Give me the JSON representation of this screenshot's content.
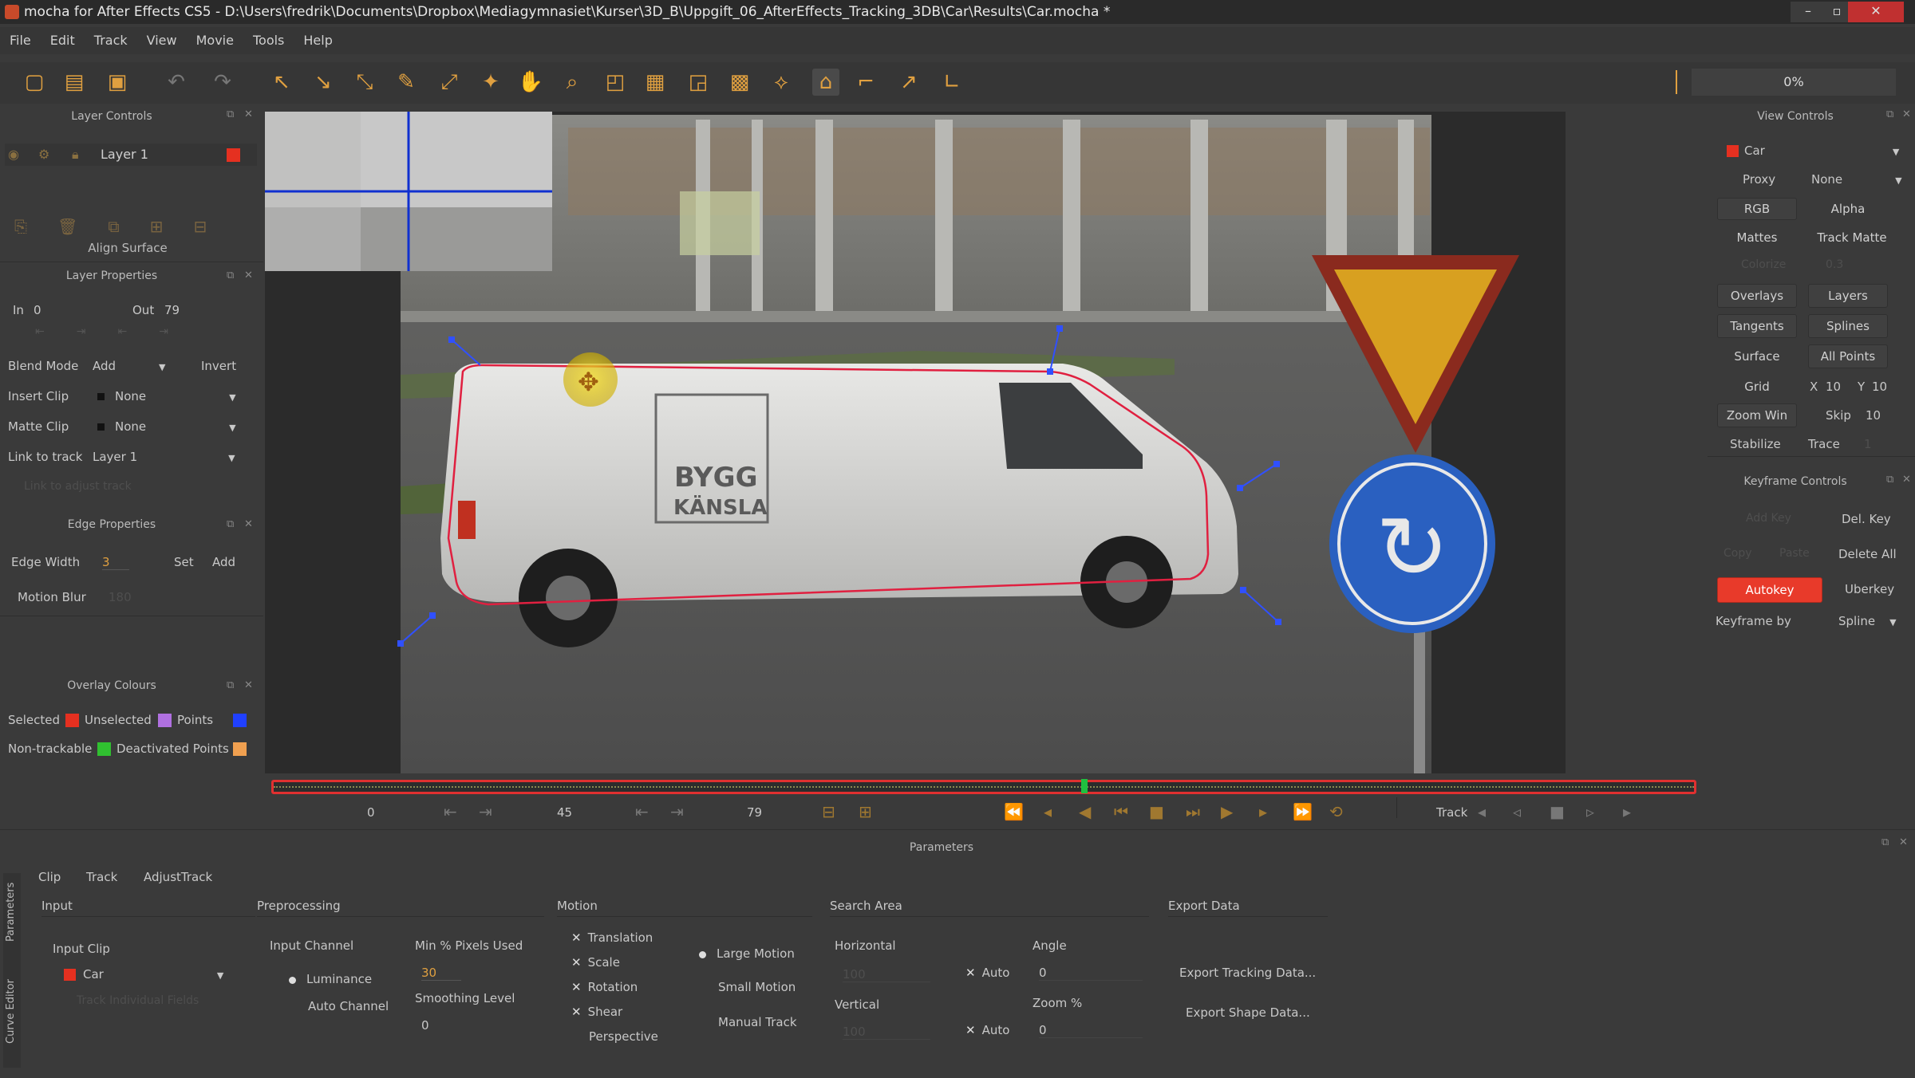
{
  "title": "mocha for After Effects CS5 - D:\\Users\\fredrik\\Documents\\Dropbox\\Mediagymnasiet\\Kurser\\3D_B\\Uppgift_06_AfterEffects_Tracking_3DB\\Car\\Results\\Car.mocha *",
  "menu": [
    "File",
    "Edit",
    "Track",
    "View",
    "Movie",
    "Tools",
    "Help"
  ],
  "progress": "0%",
  "layer_controls": {
    "header": "Layer Controls",
    "layer_name": "Layer 1",
    "align_surface": "Align Surface"
  },
  "layer_properties": {
    "header": "Layer Properties",
    "in_label": "In",
    "in_value": "0",
    "out_label": "Out",
    "out_value": "79",
    "blend_mode_label": "Blend Mode",
    "blend_mode_value": "Add",
    "invert": "Invert",
    "insert_clip_label": "Insert Clip",
    "insert_clip_value": "None",
    "matte_clip_label": "Matte Clip",
    "matte_clip_value": "None",
    "link_to_track_label": "Link to track",
    "link_to_track_value": "Layer 1",
    "link_to_adjust": "Link to adjust track"
  },
  "edge_properties": {
    "header": "Edge Properties",
    "edge_width_label": "Edge Width",
    "edge_width_value": "3",
    "set": "Set",
    "add": "Add",
    "motion_blur_label": "Motion Blur",
    "motion_blur_value": "180"
  },
  "overlay_colours": {
    "header": "Overlay Colours",
    "selected": "Selected",
    "unselected": "Unselected",
    "points": "Points",
    "non_trackable": "Non-trackable",
    "deactivated_points": "Deactivated Points",
    "colors": {
      "selected": "#e53020",
      "unselected": "#b070e0",
      "points": "#2040ff",
      "non_trackable": "#30c030",
      "deactivated": "#f0a050"
    }
  },
  "view_controls": {
    "header": "View Controls",
    "clip": "Car",
    "proxy_label": "Proxy",
    "proxy_value": "None",
    "rgb": "RGB",
    "alpha": "Alpha",
    "mattes": "Mattes",
    "track_matte": "Track Matte",
    "colorize": "Colorize",
    "colorize_value": "0.3",
    "overlays": "Overlays",
    "layers": "Layers",
    "tangents": "Tangents",
    "splines": "Splines",
    "surface": "Surface",
    "all_points": "All Points",
    "grid": "Grid",
    "grid_x_label": "X",
    "grid_x": "10",
    "grid_y_label": "Y",
    "grid_y": "10",
    "zoom_win": "Zoom Win",
    "skip": "Skip",
    "skip_value": "10",
    "stabilize": "Stabilize",
    "trace": "Trace",
    "trace_value": "1"
  },
  "keyframe_controls": {
    "header": "Keyframe Controls",
    "add_key": "Add Key",
    "del_key": "Del. Key",
    "copy": "Copy",
    "paste": "Paste",
    "delete_all": "Delete All",
    "autokey": "Autokey",
    "uberkey": "Uberkey",
    "keyframe_by_label": "Keyframe by",
    "keyframe_by_value": "Spline"
  },
  "timeline": {
    "start": "0",
    "mid": "45",
    "end": "79",
    "track_label": "Track"
  },
  "parameters": {
    "header": "Parameters",
    "tabs": [
      "Clip",
      "Track",
      "AdjustTrack"
    ],
    "side_tabs": [
      "Parameters",
      "Curve Editor"
    ],
    "input": {
      "header": "Input",
      "input_clip_label": "Input Clip",
      "input_clip_value": "Car",
      "track_individual": "Track Individual Fields"
    },
    "preprocessing": {
      "header": "Preprocessing",
      "input_channel_label": "Input Channel",
      "luminance": "Luminance",
      "auto_channel": "Auto Channel",
      "min_pixels_label": "Min % Pixels Used",
      "min_pixels_value": "30",
      "smoothing_label": "Smoothing Level",
      "smoothing_value": "0"
    },
    "motion": {
      "header": "Motion",
      "translation": "Translation",
      "scale": "Scale",
      "rotation": "Rotation",
      "shear": "Shear",
      "perspective": "Perspective",
      "large_motion": "Large Motion",
      "small_motion": "Small Motion",
      "manual_track": "Manual Track"
    },
    "search_area": {
      "header": "Search Area",
      "horizontal": "Horizontal",
      "horizontal_value": "100",
      "vertical": "Vertical",
      "vertical_value": "100",
      "auto": "Auto",
      "angle": "Angle",
      "angle_value": "0",
      "zoom": "Zoom %",
      "zoom_value": "0"
    },
    "export_data": {
      "header": "Export Data",
      "export_tracking": "Export Tracking Data...",
      "export_shape": "Export Shape Data..."
    }
  },
  "scene": {
    "van_text_1": "BYGG",
    "van_text_2": "KÄNSLA"
  }
}
